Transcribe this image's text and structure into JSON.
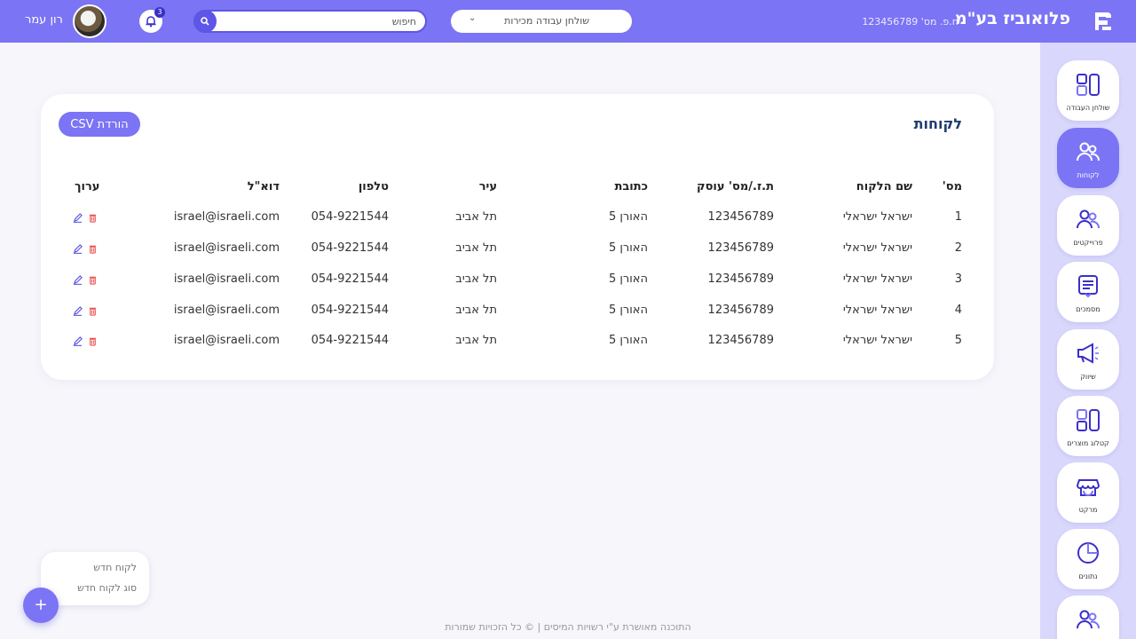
{
  "header": {
    "company_name": "פלואוביז בע\"מ",
    "company_id": "ח.פ. מס' 123456789",
    "workspace_select": "שולחן עבודה מכירות",
    "search_placeholder": "חיפוש",
    "notification_count": "3",
    "user_name": "רון עמר"
  },
  "sidebar": {
    "items": [
      {
        "label": "שולחן העבודה",
        "icon": "dashboard-icon"
      },
      {
        "label": "לקוחות",
        "icon": "users-icon",
        "active": true
      },
      {
        "label": "פרוייקטים",
        "icon": "users-icon"
      },
      {
        "label": "מסמכים",
        "icon": "document-icon"
      },
      {
        "label": "שיווק",
        "icon": "megaphone-icon"
      },
      {
        "label": "קטלוג מוצרים",
        "icon": "dashboard-icon"
      },
      {
        "label": "מרקט",
        "icon": "store-icon"
      },
      {
        "label": "נתונים",
        "icon": "pie-chart-icon"
      },
      {
        "label": "",
        "icon": "users-icon"
      }
    ]
  },
  "customers": {
    "title": "לקוחות",
    "csv_button": "הורדת CSV",
    "columns": {
      "num": "מס'",
      "name": "שם הלקוח",
      "id": "ת.ז./מס' עוסק",
      "address": "כתובת",
      "city": "עיר",
      "phone": "טלפון",
      "email": "דוא\"ל",
      "edit": "ערוך"
    },
    "rows": [
      {
        "num": "1",
        "name": "ישראל ישראלי",
        "id": "123456789",
        "address": "האורן 5",
        "city": "תל אביב",
        "phone": "054-9221544",
        "email": "israel@israeli.com"
      },
      {
        "num": "2",
        "name": "ישראל ישראלי",
        "id": "123456789",
        "address": "האורן 5",
        "city": "תל אביב",
        "phone": "054-9221544",
        "email": "israel@israeli.com"
      },
      {
        "num": "3",
        "name": "ישראל ישראלי",
        "id": "123456789",
        "address": "האורן 5",
        "city": "תל אביב",
        "phone": "054-9221544",
        "email": "israel@israeli.com"
      },
      {
        "num": "4",
        "name": "ישראל ישראלי",
        "id": "123456789",
        "address": "האורן 5",
        "city": "תל אביב",
        "phone": "054-9221544",
        "email": "israel@israeli.com"
      },
      {
        "num": "5",
        "name": "ישראל ישראלי",
        "id": "123456789",
        "address": "האורן 5",
        "city": "תל אביב",
        "phone": "054-9221544",
        "email": "israel@israeli.com"
      }
    ]
  },
  "fab_menu": {
    "new_customer": "לקוח חדש",
    "new_customer_type": "סוג לקוח חדש",
    "fab_label": "+"
  },
  "footer": "התוכנה מאושרת ע\"י רשויות המיסים | © כל הזכויות שמורות",
  "colors": {
    "primary": "#7b74f4",
    "sidebar_bg": "#d9d7fb",
    "title": "#1f3c6b",
    "edit": "#5e56e6",
    "delete": "#e84b4b"
  }
}
